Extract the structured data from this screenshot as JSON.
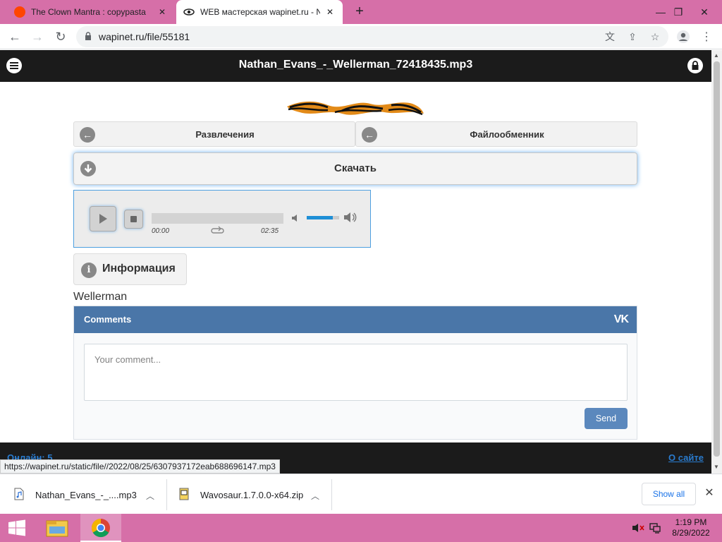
{
  "browser": {
    "tabs": [
      {
        "title": "The Clown Mantra : copypasta",
        "favicon": "reddit-icon",
        "active": false
      },
      {
        "title": "WEB мастерская wapinet.ru - Na",
        "favicon": "eye-icon",
        "active": true
      }
    ],
    "url": "wapinet.ru/file/55181",
    "status_url": "https://wapinet.ru/static/file//2022/08/25/6307937172eab688696147.mp3"
  },
  "site": {
    "title": "Nathan_Evans_-_Wellerman_72418435.mp3",
    "nav": {
      "left_label": "Развлечения",
      "right_label": "Файлообменник"
    },
    "download_label": "Скачать",
    "player": {
      "current_time": "00:00",
      "duration": "02:35",
      "progress": 0,
      "volume": 0.8
    },
    "info_label": "Информация",
    "description": "Wellerman",
    "comments": {
      "header": "Comments",
      "placeholder": "Your comment...",
      "send_label": "Send"
    },
    "footer": {
      "online": "Онлайн: 5",
      "about": "О сайте"
    }
  },
  "downloads": {
    "items": [
      {
        "name": "Nathan_Evans_-_....mp3",
        "icon": "audio-file-icon"
      },
      {
        "name": "Wavosaur.1.7.0.0-x64.zip",
        "icon": "zip-file-icon"
      }
    ],
    "show_all": "Show all"
  },
  "taskbar": {
    "time": "1:19 PM",
    "date": "8/29/2022"
  },
  "colors": {
    "tabstrip": "#d66fa8",
    "site_header": "#1b1b1b",
    "vk_blue": "#4a76a8",
    "send_button": "#5b88bd",
    "link_blue": "#2a7ccf"
  }
}
